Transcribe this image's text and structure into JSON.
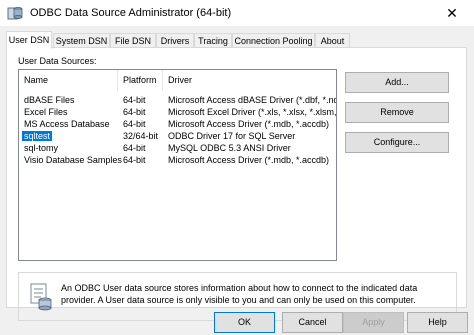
{
  "window": {
    "title": "ODBC Data Source Administrator (64-bit)",
    "close_glyph": "✕"
  },
  "tabs": [
    {
      "label": "User DSN",
      "active": true
    },
    {
      "label": "System DSN",
      "active": false
    },
    {
      "label": "File DSN",
      "active": false
    },
    {
      "label": "Drivers",
      "active": false
    },
    {
      "label": "Tracing",
      "active": false
    },
    {
      "label": "Connection Pooling",
      "active": false
    },
    {
      "label": "About",
      "active": false
    }
  ],
  "user_dsn": {
    "section_label": "User Data Sources:",
    "columns": [
      "Name",
      "Platform",
      "Driver"
    ],
    "rows": [
      {
        "name": "dBASE Files",
        "platform": "64-bit",
        "driver": "Microsoft Access dBASE Driver (*.dbf, *.ndx,"
      },
      {
        "name": "Excel Files",
        "platform": "64-bit",
        "driver": "Microsoft Excel Driver (*.xls, *.xlsx, *.xlsm, *."
      },
      {
        "name": "MS Access Database",
        "platform": "64-bit",
        "driver": "Microsoft Access Driver (*.mdb, *.accdb)"
      },
      {
        "name": "sqltest",
        "platform": "32/64-bit",
        "driver": "ODBC Driver 17 for SQL Server",
        "selected": true
      },
      {
        "name": "sql-tomy",
        "platform": "64-bit",
        "driver": "MySQL ODBC 5.3 ANSI Driver"
      },
      {
        "name": "Visio Database Samples",
        "platform": "64-bit",
        "driver": "Microsoft Access Driver (*.mdb, *.accdb)"
      }
    ],
    "buttons": {
      "add": "Add...",
      "remove": "Remove",
      "configure": "Configure..."
    },
    "info_text": "An ODBC User data source stores information about how to connect to the indicated data provider.   A User data source is only visible to you and can only be used on this computer."
  },
  "footer": {
    "ok": "OK",
    "cancel": "Cancel",
    "apply": "Apply",
    "help": "Help"
  },
  "colors": {
    "selection": "#0078d7",
    "window_bg": "#f0f0f0",
    "panel_bg": "#ffffff"
  }
}
